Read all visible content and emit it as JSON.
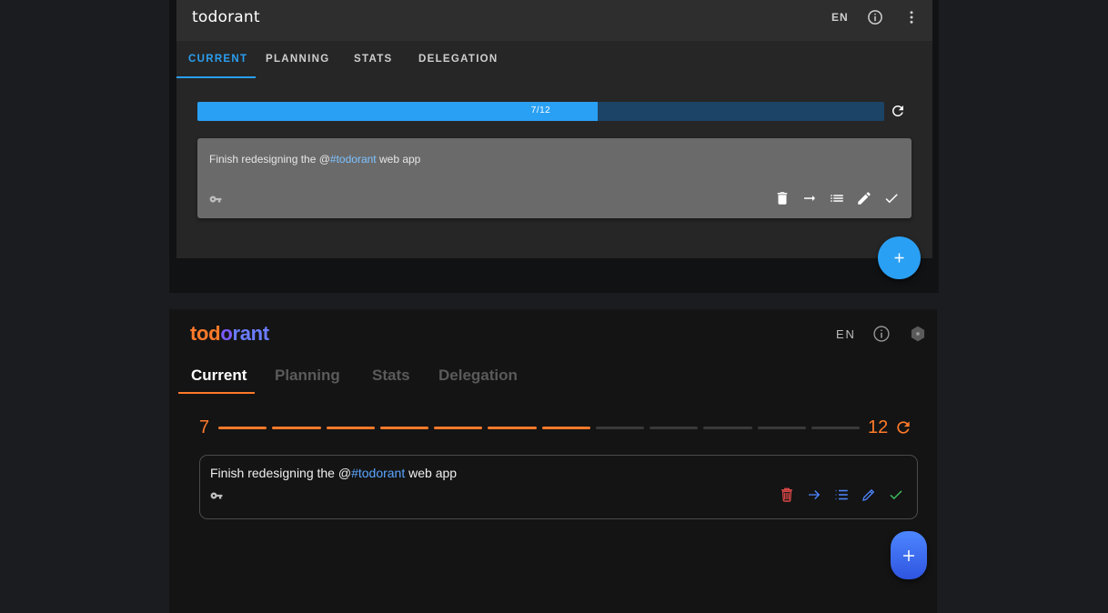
{
  "old_app": {
    "logo": {
      "part1": "tod",
      "accent": "o",
      "part2": "rant"
    },
    "header": {
      "language": "EN",
      "info_icon": "info-icon",
      "more_icon": "more-vert-icon"
    },
    "tabs": [
      {
        "label": "CURRENT",
        "active": true
      },
      {
        "label": "PLANNING",
        "active": false
      },
      {
        "label": "STATS",
        "active": false
      },
      {
        "label": "DELEGATION",
        "active": false
      }
    ],
    "progress": {
      "completed": 7,
      "total": 12,
      "label": "7/12",
      "fraction": 0.5833
    },
    "todo": {
      "text_before": "Finish redesigning the @",
      "hashtag": "#todorant",
      "text_after": " web app",
      "icons": [
        "key-icon",
        "delete-icon",
        "arrow-right-icon",
        "list-icon",
        "edit-icon",
        "check-icon"
      ]
    },
    "fab_icon": "plus-icon",
    "colors": {
      "accent": "#2aa0f4",
      "card": "#6a6a6a",
      "header": "#2e2e2e"
    }
  },
  "new_app": {
    "logo": {
      "part1": "tod",
      "accent": "o",
      "part2": "rant"
    },
    "header": {
      "language": "EN",
      "info_icon": "info-icon",
      "extra_icon": "hexagon-icon"
    },
    "tabs": [
      {
        "label": "Current",
        "active": true
      },
      {
        "label": "Planning",
        "active": false
      },
      {
        "label": "Stats",
        "active": false
      },
      {
        "label": "Delegation",
        "active": false
      }
    ],
    "progress": {
      "completed": 7,
      "total": 12,
      "left_label": "7",
      "right_label": "12",
      "segments": 12,
      "filled_segments": 7
    },
    "todo": {
      "text_before": "Finish redesigning the @",
      "hashtag": "#todorant",
      "text_after": " web app",
      "icons": [
        "key-icon",
        "delete-icon",
        "arrow-right-icon",
        "list-icon",
        "edit-icon",
        "check-icon"
      ]
    },
    "fab_icon": "plus-icon",
    "colors": {
      "accent": "#ff7a2a",
      "blue": "#4d86ff",
      "delete": "#e84a4a",
      "check": "#3fbf5f",
      "segment_empty": "#3a3a3a"
    }
  }
}
